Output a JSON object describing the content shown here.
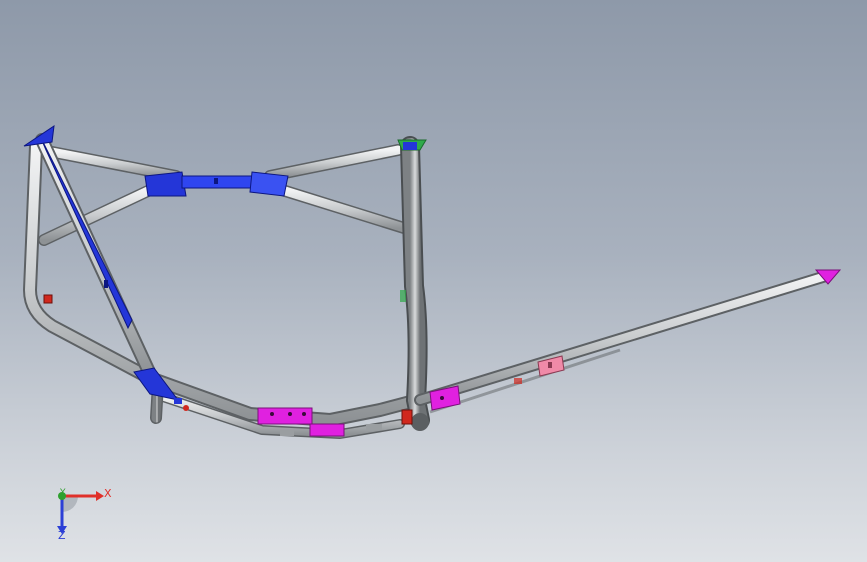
{
  "viewport": {
    "background_top": "#8e99a9",
    "background_bottom": "#dfe2e6"
  },
  "model": {
    "tube_color": "#cfd2d4",
    "tube_edge_color": "#5d6164",
    "bracket_blue": "#2436d8",
    "bracket_magenta": "#e021e0",
    "bracket_pink": "#f08aa8",
    "bracket_red": "#d0281e",
    "bracket_green": "#2faa4a"
  },
  "triad": {
    "x_label": "X",
    "y_label": "Y",
    "z_label": "Z",
    "x_color": "#e0302a",
    "y_color": "#2fa02f",
    "z_color": "#2b3fd6"
  }
}
